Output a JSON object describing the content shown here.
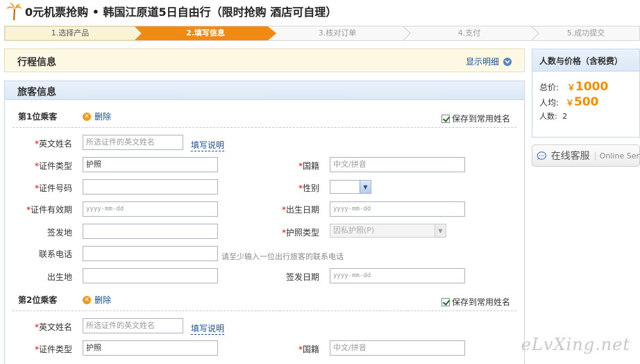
{
  "page": {
    "title": "0元机票抢购 • 韩国江原道5日自由行（限时抢购 酒店可自理）"
  },
  "steps": [
    {
      "label": "1.选择产品"
    },
    {
      "label": "2.填写信息"
    },
    {
      "label": "3.核对订单"
    },
    {
      "label": "4.支付"
    },
    {
      "label": "5.成功提交"
    }
  ],
  "trip": {
    "heading": "行程信息",
    "show_details": "显示明细"
  },
  "passenger_section": {
    "heading": "旅客信息",
    "delete_label": "删除",
    "save_label": "保存到常用姓名",
    "fill_help": "填写说明",
    "required_mark": "*"
  },
  "passengers": [
    {
      "title": "第1位乘客",
      "english_name": {
        "label": "英文姓名",
        "placeholder": "所选证件的英文姓名"
      },
      "id_type": {
        "label": "证件类型",
        "value": "护照"
      },
      "nationality": {
        "label": "国籍",
        "placeholder": "中文/拼音"
      },
      "id_number": {
        "label": "证件号码",
        "value": ""
      },
      "gender": {
        "label": "性别",
        "value": ""
      },
      "id_expiry": {
        "label": "证件有效期",
        "placeholder": "yyyy-mm-dd"
      },
      "birth_date": {
        "label": "出生日期",
        "placeholder": "yyyy-mm-dd"
      },
      "issue_place": {
        "label": "签发地",
        "value": ""
      },
      "passport_type": {
        "label": "护照类型",
        "value": "因私护照(P)"
      },
      "phone": {
        "label": "联系电话",
        "value": "",
        "hint": "请至少输入一位出行旅客的联系电话"
      },
      "birth_place": {
        "label": "出生地",
        "value": ""
      },
      "issue_date": {
        "label": "签发日期",
        "placeholder": "yyyy-mm-dd"
      }
    },
    {
      "title": "第2位乘客",
      "english_name": {
        "label": "英文姓名",
        "placeholder": "所选证件的英文姓名"
      },
      "id_type": {
        "label": "证件类型",
        "value": "护照"
      },
      "nationality": {
        "label": "国籍",
        "placeholder": "中文/拼音"
      }
    }
  ],
  "summary": {
    "heading": "人数与价格（含税费）",
    "total_label": "总价:",
    "currency": "￥",
    "total_value": "1000",
    "avg_label": "人均:",
    "avg_value": "500",
    "count_label": "人数:",
    "count_value": "2"
  },
  "customer_service": {
    "label": "在线客服",
    "label_en": "Online Ser"
  },
  "watermark": "eLvXing.net",
  "colors": {
    "active_step": "#f08a12",
    "price": "#f18f05",
    "link": "#1a4fa0",
    "required": "#e00000"
  }
}
